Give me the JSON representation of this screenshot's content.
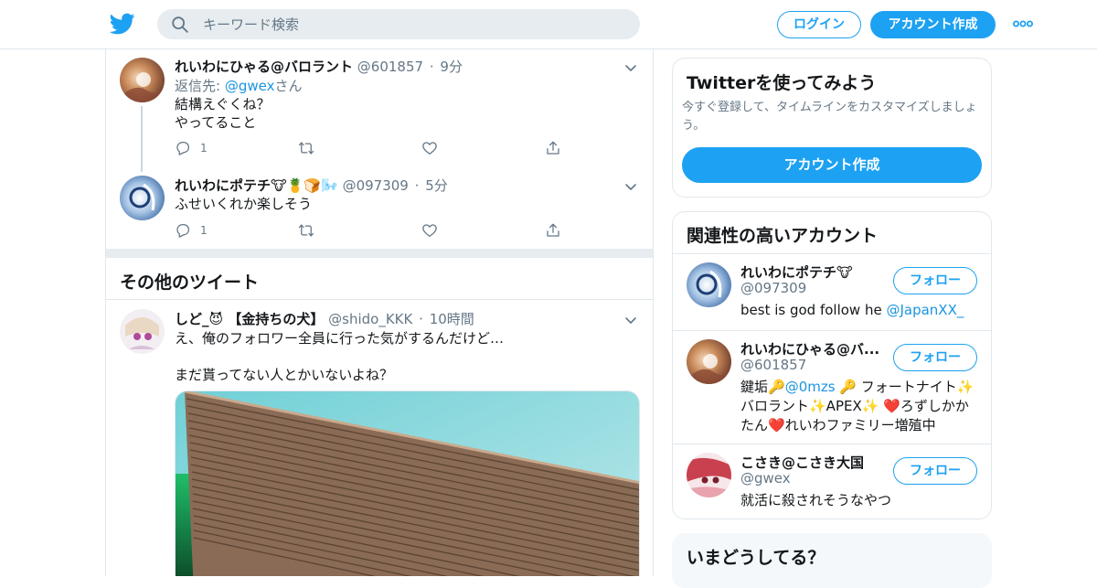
{
  "header": {
    "logo_icon": "twitter-bird-icon",
    "search_placeholder": "キーワード検索",
    "login_label": "ログイン",
    "signup_label": "アカウント作成",
    "more_icon": "more-dots-icon",
    "accent": "#1da1f2"
  },
  "timeline": {
    "tweets": [
      {
        "name": "れいわにひゃる@バロラント",
        "handle": "@601857",
        "time": "9分",
        "reply_prefix": "返信先: ",
        "reply_mention": "@gwex",
        "reply_suffix": "さん",
        "text": "結構えぐくね？\nやってること",
        "reply_count": "1"
      },
      {
        "name": "れいわにポテチ🐮🍍🍞🌬️",
        "handle": "@097309",
        "time": "5分",
        "text": "ふせいくれか楽しそう",
        "reply_count": "1"
      }
    ],
    "more_tweets_title": "その他のツイート",
    "other_tweet": {
      "name": "しど_😈 【金持ちの犬】",
      "handle": "@shido_KKK",
      "time": "10時間",
      "text": "え、俺のフォロワー全員に行った気がするんだけど…\n\nまだ貰ってない人とかいないよね？"
    }
  },
  "sidebar": {
    "signup_card": {
      "title": "Twitterを使ってみよう",
      "subtitle": "今すぐ登録して、タイムラインをカスタマイズしましょう。",
      "button": "アカウント作成"
    },
    "related": {
      "title": "関連性の高いアカウント",
      "follow_label": "フォロー",
      "accounts": [
        {
          "name": "れいわにポテチ🐮",
          "handle": "@097309",
          "bio_text": "best is god follow he ",
          "bio_mention": "@JapanXX_"
        },
        {
          "name": "れいわにひゃる@バ...",
          "handle": "@601857",
          "bio_a": "鍵垢🔑",
          "bio_mention": "@0mzs",
          "bio_b": " 🔑 フォートナイト✨バロラント✨APEX✨ ❤️ろずしかかたん❤️れいわファミリー増殖中"
        },
        {
          "name": "こさき@こさき大国",
          "handle": "@gwex",
          "bio_text": "就活に殺されそうなやつ"
        }
      ]
    },
    "trends_title": "いまどうしてる？"
  }
}
